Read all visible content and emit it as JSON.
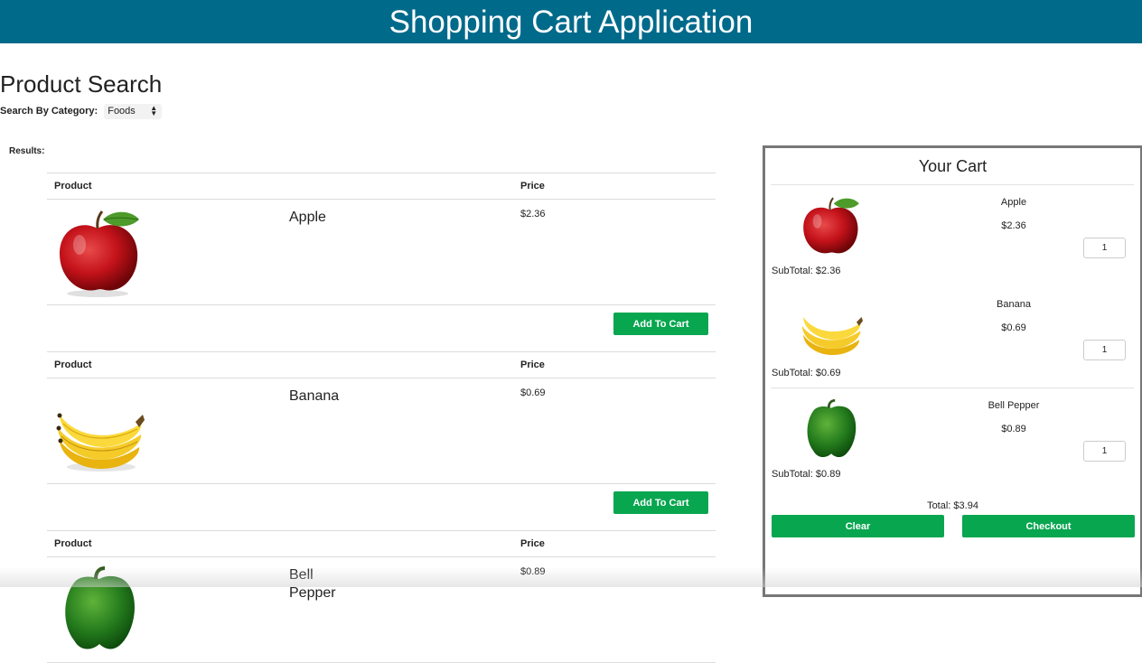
{
  "app": {
    "title": "Shopping Cart Application"
  },
  "search": {
    "heading": "Product Search",
    "category_label": "Search By Category:",
    "category_value": "Foods",
    "results_label": "Results:"
  },
  "table": {
    "col_product": "Product",
    "col_price": "Price",
    "add_label": "Add To Cart"
  },
  "products": [
    {
      "name": "Apple",
      "price": "$2.36",
      "icon": "apple-icon"
    },
    {
      "name": "Banana",
      "price": "$0.69",
      "icon": "banana-icon"
    },
    {
      "name": "Bell Pepper",
      "price": "$0.89",
      "icon": "bell-pepper-icon"
    }
  ],
  "cart": {
    "title": "Your Cart",
    "items": [
      {
        "name": "Apple",
        "price": "$2.36",
        "qty": "1",
        "subtotal": "SubTotal: $2.36"
      },
      {
        "name": "Banana",
        "price": "$0.69",
        "qty": "1",
        "subtotal": "SubTotal: $0.69"
      },
      {
        "name": "Bell Pepper",
        "price": "$0.89",
        "qty": "1",
        "subtotal": "SubTotal: $0.89"
      }
    ],
    "total": "Total: $3.94",
    "clear_label": "Clear",
    "checkout_label": "Checkout"
  },
  "colors": {
    "header_bg": "#006a8b",
    "button_green": "#09a650",
    "cart_border": "#777777"
  }
}
